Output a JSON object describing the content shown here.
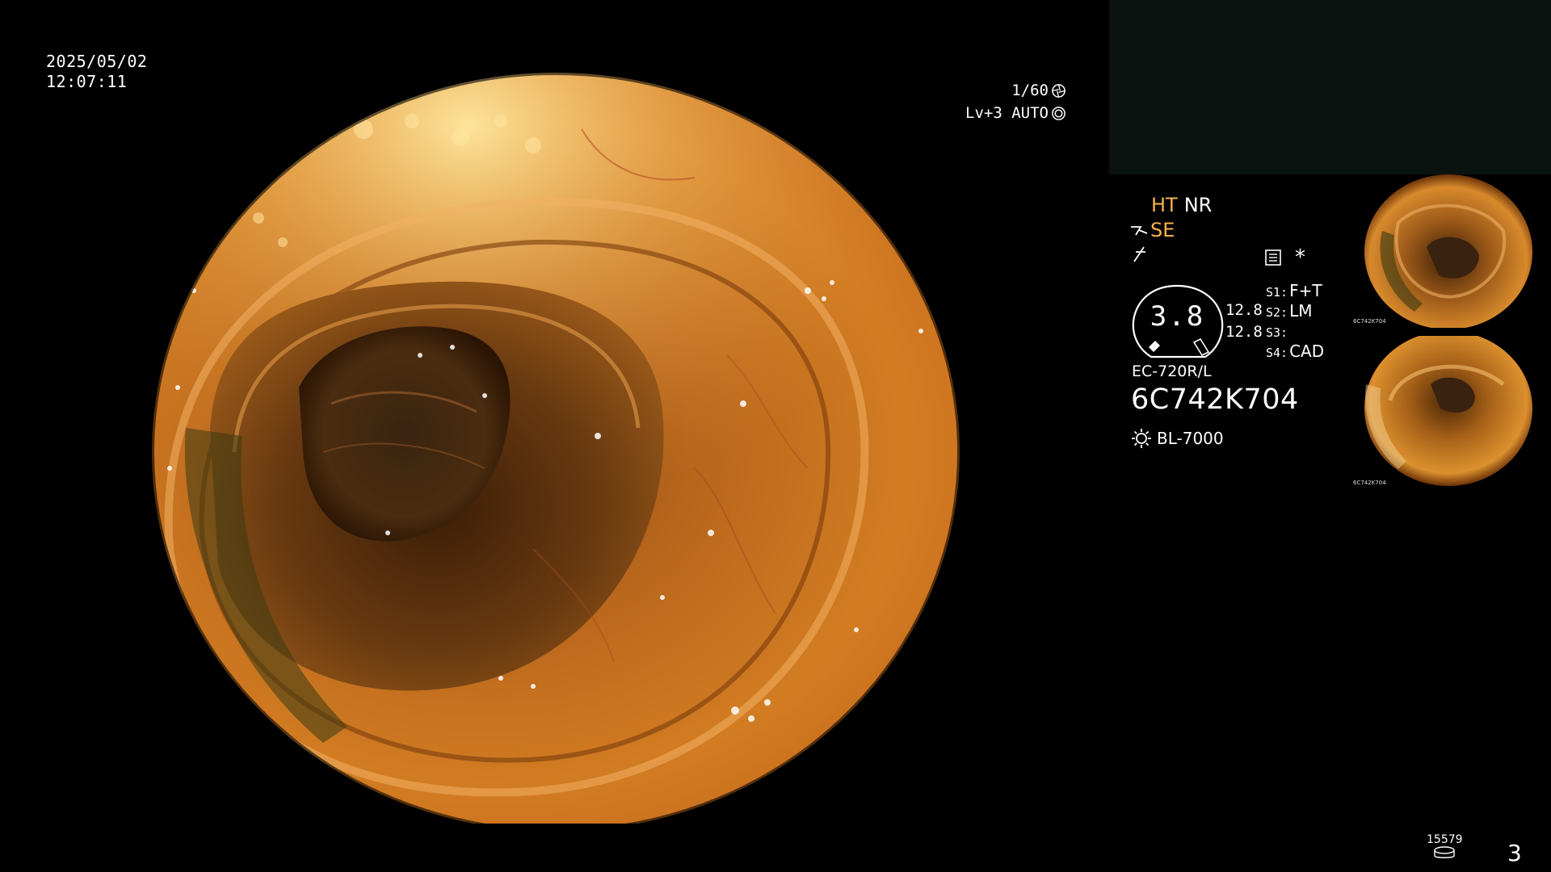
{
  "datetime": {
    "date": "2025/05/02",
    "time": "12:07:11"
  },
  "exposure": {
    "shutter": "1/60",
    "level": "Lv+3 AUTO",
    "shutter_icon": "aperture-icon",
    "auto_icon": "auto-iris-icon"
  },
  "settings": {
    "ht": "HT",
    "nr": "NR",
    "se": "SE",
    "highlight_color": "#f6b24a"
  },
  "zoom": {
    "value": "3.8",
    "scale_top": "12.8",
    "scale_bottom": "12.8"
  },
  "switches": [
    {
      "key": "S1:",
      "value": "F+T"
    },
    {
      "key": "S2:",
      "value": "LM"
    },
    {
      "key": "S3:",
      "value": ""
    },
    {
      "key": "S4:",
      "value": "CAD"
    }
  ],
  "scope": {
    "model": "EC-720R/L",
    "serial": "6C742K704",
    "light_source": "BL-7000"
  },
  "aux": {
    "asterisk": "*"
  },
  "thumbnails": [
    {
      "label": "6C742K704"
    },
    {
      "label": "6C742K704"
    }
  ],
  "counter": {
    "images": "15579",
    "page": "3"
  },
  "colors": {
    "background": "#000000",
    "panel": "#0b1311",
    "text": "#ffffff"
  }
}
